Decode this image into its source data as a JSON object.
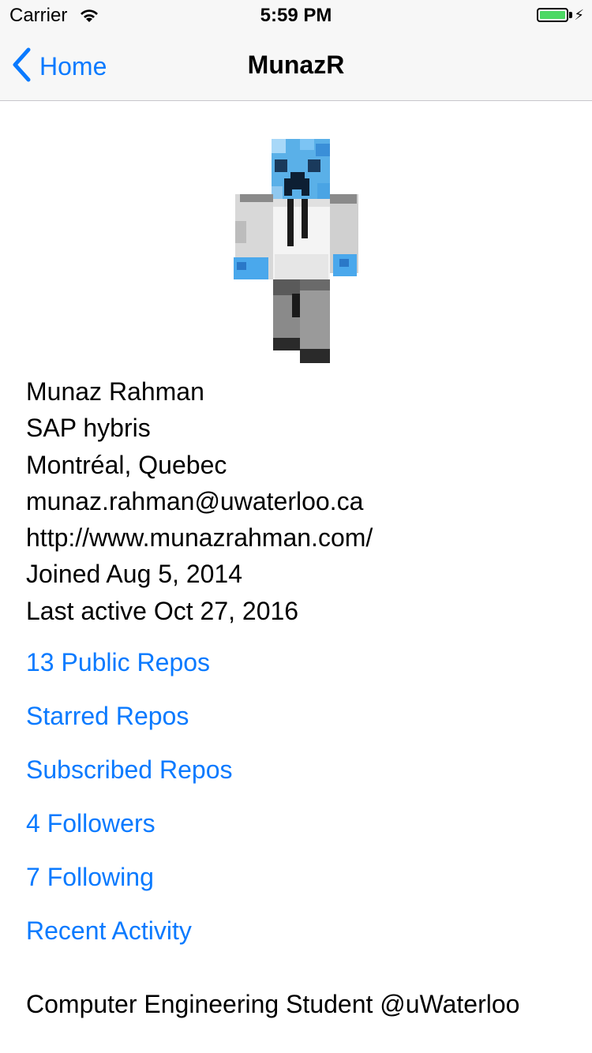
{
  "status_bar": {
    "carrier": "Carrier",
    "time": "5:59 PM",
    "battery_color": "#4cd964"
  },
  "nav": {
    "back_label": "Home",
    "title": "MunazR",
    "accent_color": "#0a7aff"
  },
  "profile": {
    "avatar": "minecraft-skin-avatar",
    "name": "Munaz Rahman",
    "company": "SAP hybris",
    "location": "Montréal, Quebec",
    "email": "munaz.rahman@uwaterloo.ca",
    "website": "http://www.munazrahman.com/",
    "joined": "Joined Aug 5, 2014",
    "last_active": "Last active Oct 27, 2016"
  },
  "links": [
    {
      "label": "13 Public Repos"
    },
    {
      "label": "Starred Repos"
    },
    {
      "label": "Subscribed Repos"
    },
    {
      "label": "4 Followers"
    },
    {
      "label": "7 Following"
    },
    {
      "label": "Recent Activity"
    }
  ],
  "bio": "Computer Engineering Student @uWaterloo"
}
